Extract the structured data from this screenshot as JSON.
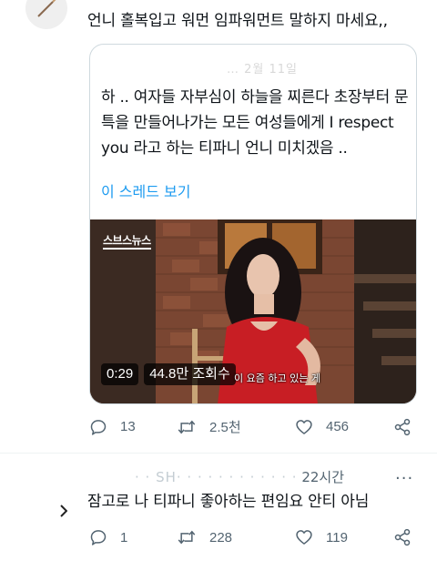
{
  "tweet1": {
    "text": "언니 홀복입고 워먼 임파워먼트 말하지 마세요,,",
    "quote": {
      "header_faded": "… 2월 11일",
      "body": "하 .. 여자들 자부심이 하늘을 찌른다 초장부터 문특을 만들어나가는 모든 여성들에게 I respect you 라고 하는 티파니 언니 미치겠음 ..",
      "show_thread": "이 스레드 보기",
      "video": {
        "logo": "스브스뉴스",
        "duration": "0:29",
        "views": "44.8만 조회수",
        "subtitle": "이 요즘 하고 있는 게"
      }
    },
    "actions": {
      "replies": "13",
      "retweets": "2.5천",
      "likes": "456"
    }
  },
  "tweet2": {
    "header_blurred": "· · SH· · ·  · · · ·  · · · ·  ·",
    "time": "22시간",
    "more": "···",
    "text": "잠고로 나 티파니 좋아하는 편임요 안티 아님",
    "actions": {
      "replies": "1",
      "retweets": "228",
      "likes": "119"
    }
  },
  "colors": {
    "accent": "#1d9bf0",
    "secondary_text": "#536471",
    "border": "#cfd9de"
  }
}
